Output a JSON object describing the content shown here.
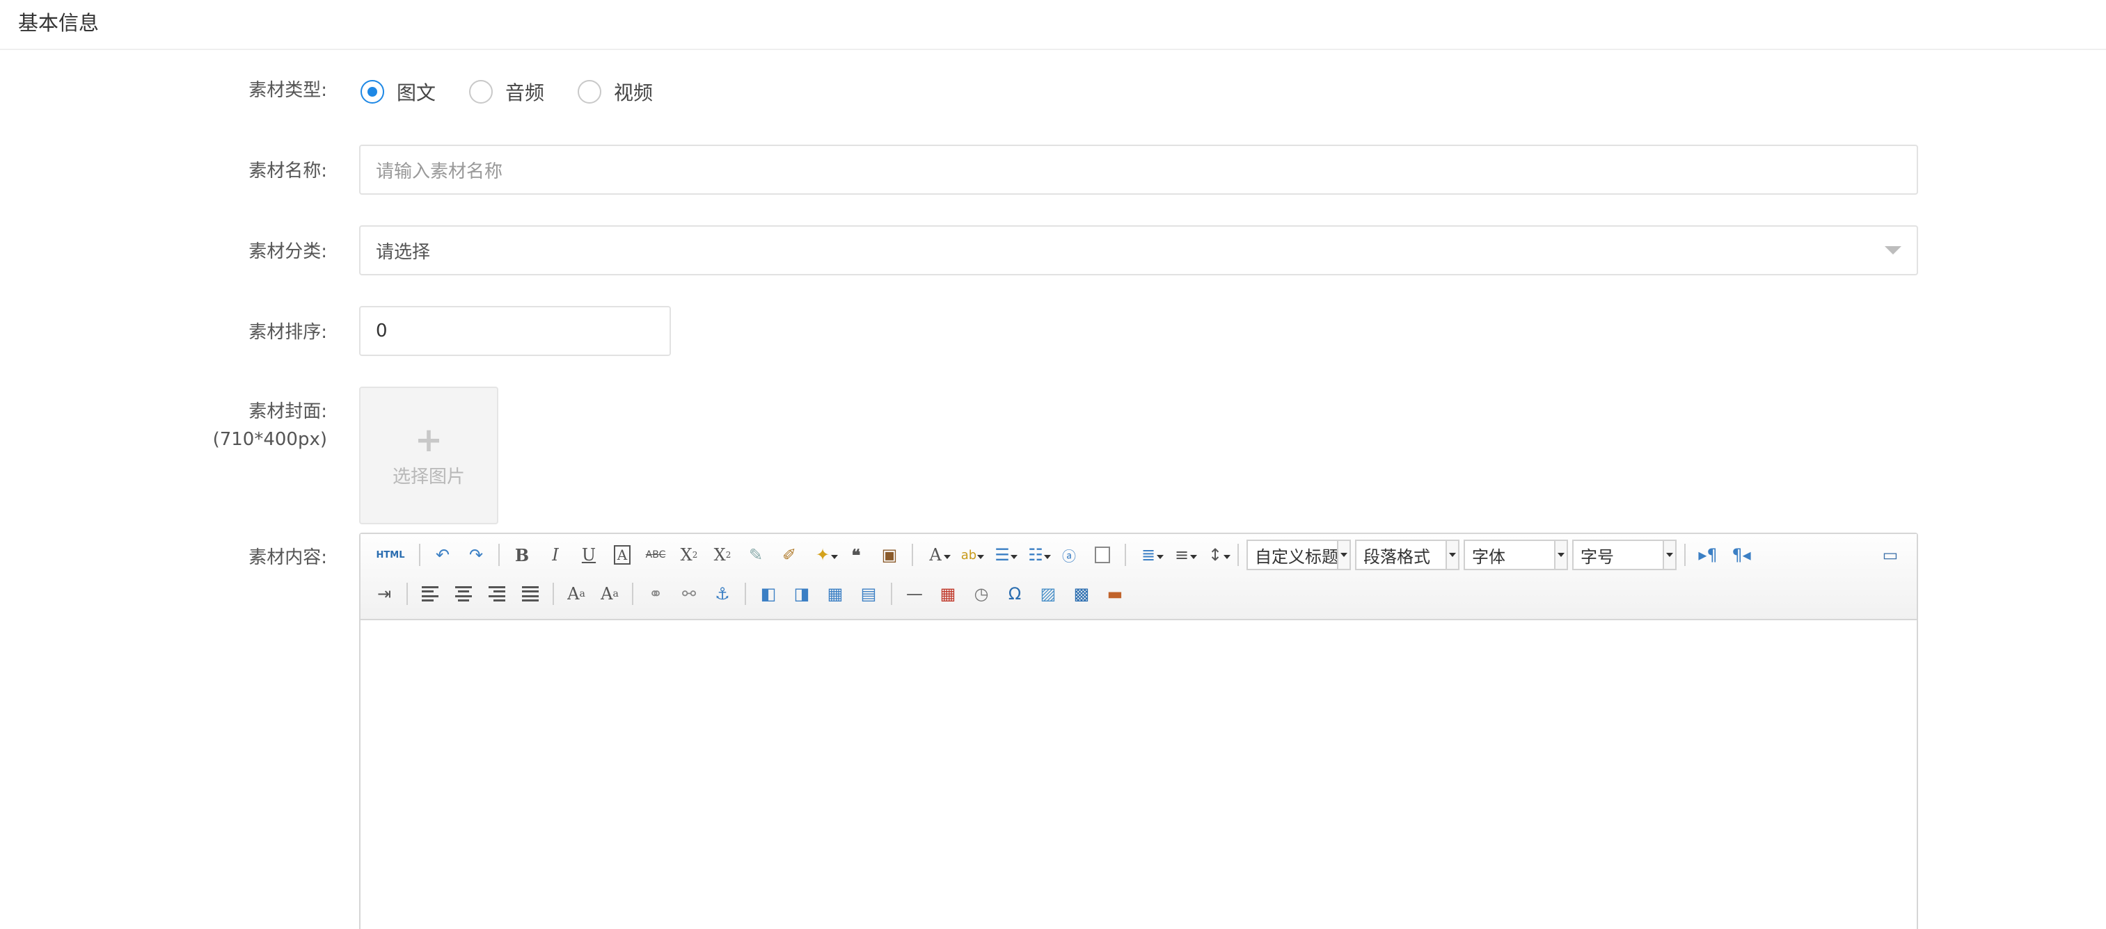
{
  "section": {
    "title": "基本信息"
  },
  "form": {
    "type_label": "素材类型:",
    "type_options": [
      {
        "label": "图文",
        "checked": true
      },
      {
        "label": "音频",
        "checked": false
      },
      {
        "label": "视频",
        "checked": false
      }
    ],
    "name_label": "素材名称:",
    "name_placeholder": "请输入素材名称",
    "category_label": "素材分类:",
    "category_value": "请选择",
    "sort_label": "素材排序:",
    "sort_value": "0",
    "cover_label": "素材封面:",
    "cover_size": "(710*400px)",
    "cover_upload_text": "选择图片",
    "content_label": "素材内容:"
  },
  "editor": {
    "html_button": "HTML",
    "custom_title_select": "自定义标题",
    "paragraph_select": "段落格式",
    "font_family_select": "字体",
    "font_size_select": "字号"
  },
  "colors": {
    "accent": "#1e88e5",
    "border": "#e2e2e2"
  }
}
